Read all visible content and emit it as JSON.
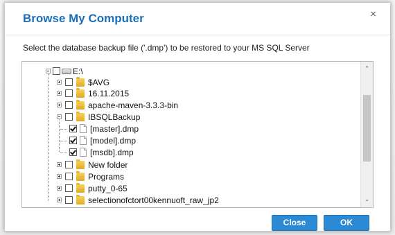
{
  "dialog": {
    "title": "Browse My Computer",
    "close_glyph": "×",
    "instruction": "Select the database backup file ('.dmp') to be restored to your MS SQL Server"
  },
  "tree": {
    "root": {
      "label": "E:\\",
      "expanded": true,
      "checked": false,
      "icon": "drive-icon"
    },
    "items": [
      {
        "label": "$AVG",
        "type": "folder",
        "expanded": false,
        "checked": false
      },
      {
        "label": "16.11.2015",
        "type": "folder",
        "expanded": false,
        "checked": false
      },
      {
        "label": "apache-maven-3.3.3-bin",
        "type": "folder",
        "expanded": false,
        "checked": false
      },
      {
        "label": "IBSQLBackup",
        "type": "folder",
        "expanded": true,
        "checked": false
      },
      {
        "label": "[master].dmp",
        "type": "file",
        "checked": true
      },
      {
        "label": "[model].dmp",
        "type": "file",
        "checked": true
      },
      {
        "label": "[msdb].dmp",
        "type": "file",
        "checked": true
      },
      {
        "label": "New folder",
        "type": "folder",
        "expanded": false,
        "checked": false
      },
      {
        "label": "Programs",
        "type": "folder",
        "expanded": false,
        "checked": false
      },
      {
        "label": "putty_0-65",
        "type": "folder",
        "expanded": false,
        "checked": false
      },
      {
        "label": "selectionofctort00kennuoft_raw_jp2",
        "type": "folder",
        "expanded": false,
        "checked": false
      }
    ]
  },
  "scrollbar": {
    "up_glyph": "⌃",
    "down_glyph": "⌄"
  },
  "buttons": {
    "close": "Close",
    "ok": "OK"
  },
  "colors": {
    "title": "#1d6fb8",
    "button": "#2b8ad3"
  }
}
